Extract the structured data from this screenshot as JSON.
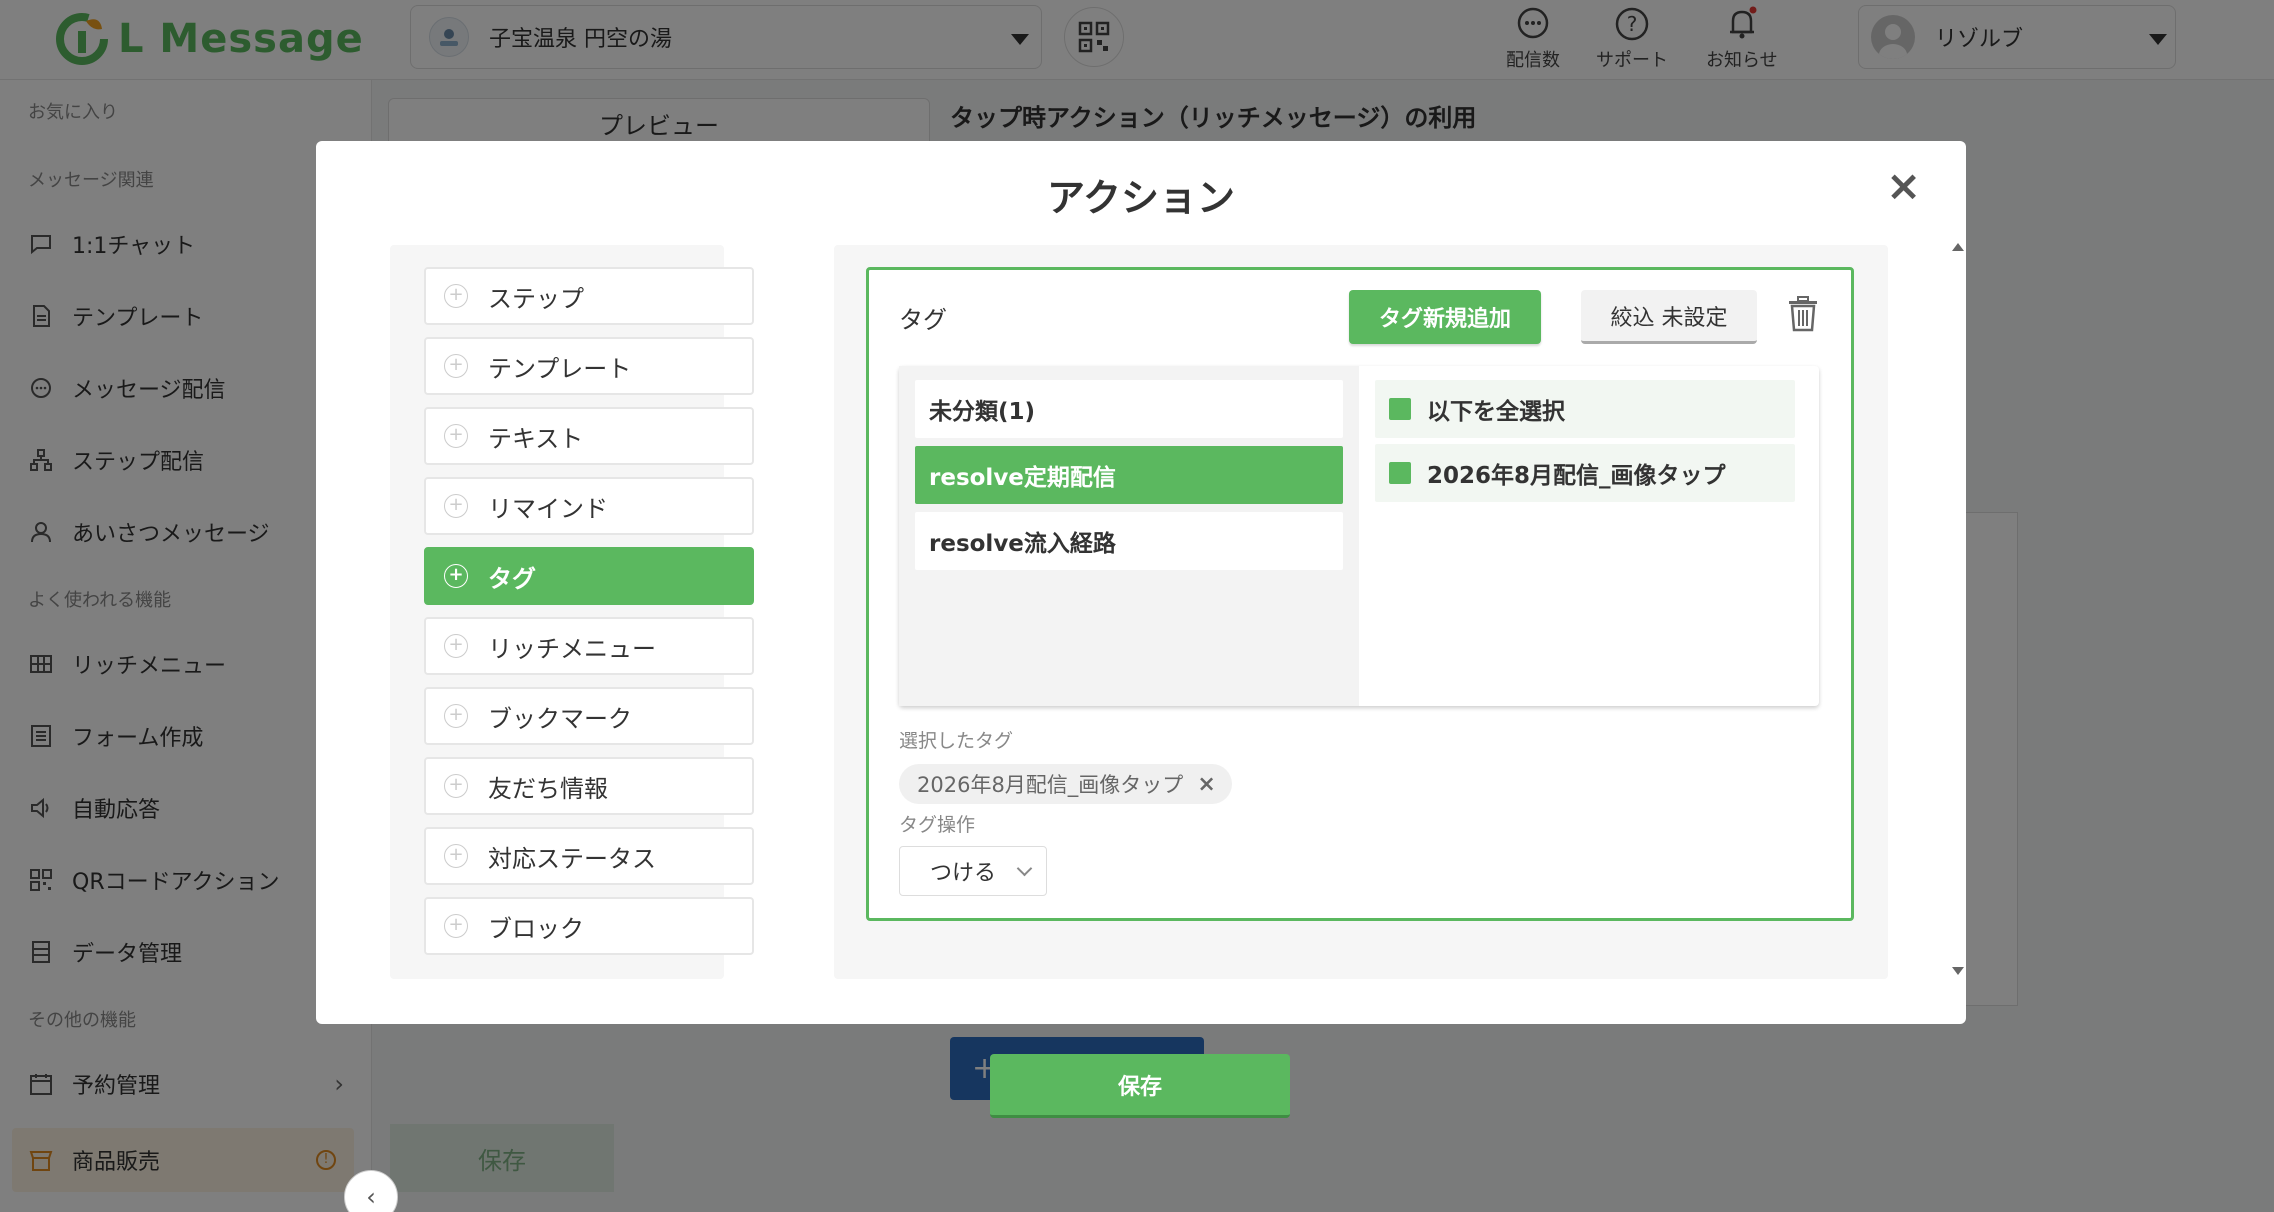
{
  "header": {
    "logo_text": "L Message",
    "store_name": "子宝温泉 円空の湯",
    "actions": [
      {
        "label": "配信数",
        "icon": "chat-bubble-icon"
      },
      {
        "label": "サポート",
        "icon": "question-icon"
      },
      {
        "label": "お知らせ",
        "icon": "bell-icon"
      }
    ],
    "user_name": "リゾルブ"
  },
  "sidebar": {
    "sections": [
      "お気に入り",
      "メッセージ関連",
      "よく使われる機能",
      "その他の機能"
    ],
    "items": [
      {
        "label": "1:1チャット",
        "icon": "chat-icon"
      },
      {
        "label": "テンプレート",
        "icon": "document-icon"
      },
      {
        "label": "メッセージ配信",
        "icon": "message-icon"
      },
      {
        "label": "ステップ配信",
        "icon": "step-icon"
      },
      {
        "label": "あいさつメッセージ",
        "icon": "user-icon"
      },
      {
        "label": "リッチメニュー",
        "icon": "grid-icon"
      },
      {
        "label": "フォーム作成",
        "icon": "form-icon"
      },
      {
        "label": "自動応答",
        "icon": "speaker-icon"
      },
      {
        "label": "QRコードアクション",
        "icon": "qr-icon"
      },
      {
        "label": "データ管理",
        "icon": "database-icon"
      },
      {
        "label": "予約管理",
        "icon": "calendar-icon"
      },
      {
        "label": "商品販売",
        "icon": "shop-icon"
      }
    ]
  },
  "background": {
    "preview_tab": "プレビュー",
    "title": "タップ時アクション（リッチメッセージ）の利用",
    "save_label": "保存",
    "add_label": "+"
  },
  "modal": {
    "title": "アクション",
    "close": "×",
    "actions": [
      "ステップ",
      "テンプレート",
      "テキスト",
      "リマインド",
      "タグ",
      "リッチメニュー",
      "ブックマーク",
      "友だち情報",
      "対応ステータス",
      "ブロック"
    ],
    "active_action": "タグ",
    "tag": {
      "label": "タグ",
      "new_button": "タグ新規追加",
      "filter_button": "絞込 未設定",
      "folders": [
        "未分類(1)",
        "resolve定期配信",
        "resolve流入経路"
      ],
      "active_folder": "resolve定期配信",
      "tags": [
        "以下を全選択",
        "2026年8月配信_画像タップ"
      ],
      "selected_label": "選択したタグ",
      "selected_chip": "2026年8月配信_画像タップ",
      "chip_remove": "×",
      "operation_label": "タグ操作",
      "operation_value": "つける"
    },
    "save_label": "保存"
  },
  "colors": {
    "accent": "#5bb85f",
    "blue": "#2d6dbf"
  }
}
